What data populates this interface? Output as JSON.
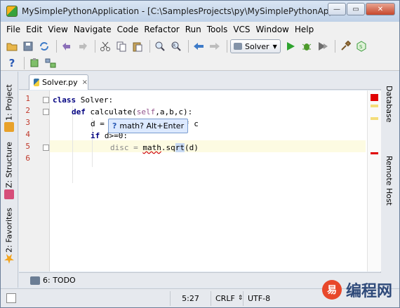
{
  "window": {
    "title": "MySimplePythonApplication - [C:\\SamplesProjects\\py\\MySimplePythonApplicat...",
    "minimize": "—",
    "maximize": "▭",
    "close": "✕"
  },
  "menu": [
    "File",
    "Edit",
    "View",
    "Navigate",
    "Code",
    "Refactor",
    "Run",
    "Tools",
    "VCS",
    "Window",
    "Help"
  ],
  "toolbar": {
    "run_config": "Solver",
    "icons_row1": [
      "open-icon",
      "save-icon",
      "sync-icon",
      "undo-icon",
      "redo-icon",
      "cut-icon",
      "copy-icon",
      "paste-icon",
      "find-icon",
      "replace-icon",
      "back-icon",
      "forward-icon",
      "run-icon",
      "debug-icon",
      "coverage-icon",
      "settings-icon",
      "sdk-icon"
    ],
    "icons_row2": [
      "help-icon",
      "module-icon",
      "structure-icon"
    ],
    "help": "?"
  },
  "left_tabs": [
    {
      "label": "1: Project"
    },
    {
      "label": "Z: Structure"
    },
    {
      "label": "2: Favorites"
    }
  ],
  "right_tabs": [
    {
      "label": "Database"
    },
    {
      "label": "Remote Host"
    }
  ],
  "editor_tab": {
    "label": "Solver.py",
    "close": "×"
  },
  "line_numbers": [
    "1",
    "2",
    "3",
    "4",
    "5",
    "6"
  ],
  "code": {
    "l1_kw": "class",
    "l1_rest": " Solver:",
    "l2_kw": "def",
    "l2_name": " calculate(",
    "l2_self": "self",
    "l2_rest": ",a,b,c):",
    "l3_a": "d = ",
    "l3_b": "* c",
    "l4_kw": "if",
    "l4_rest": " d>=0:",
    "l5_a": "disc = ",
    "l5_math": "math",
    "l5_dot": ".sq",
    "l5_rt": "rt",
    "l5_end": "(d)"
  },
  "tooltip": {
    "icon": "?",
    "text": "math? Alt+Enter"
  },
  "bottom": {
    "todo_label": "6: TODO"
  },
  "status": {
    "position": "5:27",
    "line_sep": "CRLF",
    "encoding": "UTF-8"
  },
  "watermark": {
    "logo": "易",
    "text": "编程网"
  },
  "colors": {
    "error_mark": "#e00000",
    "warning_mark": "#f4dd7a"
  }
}
